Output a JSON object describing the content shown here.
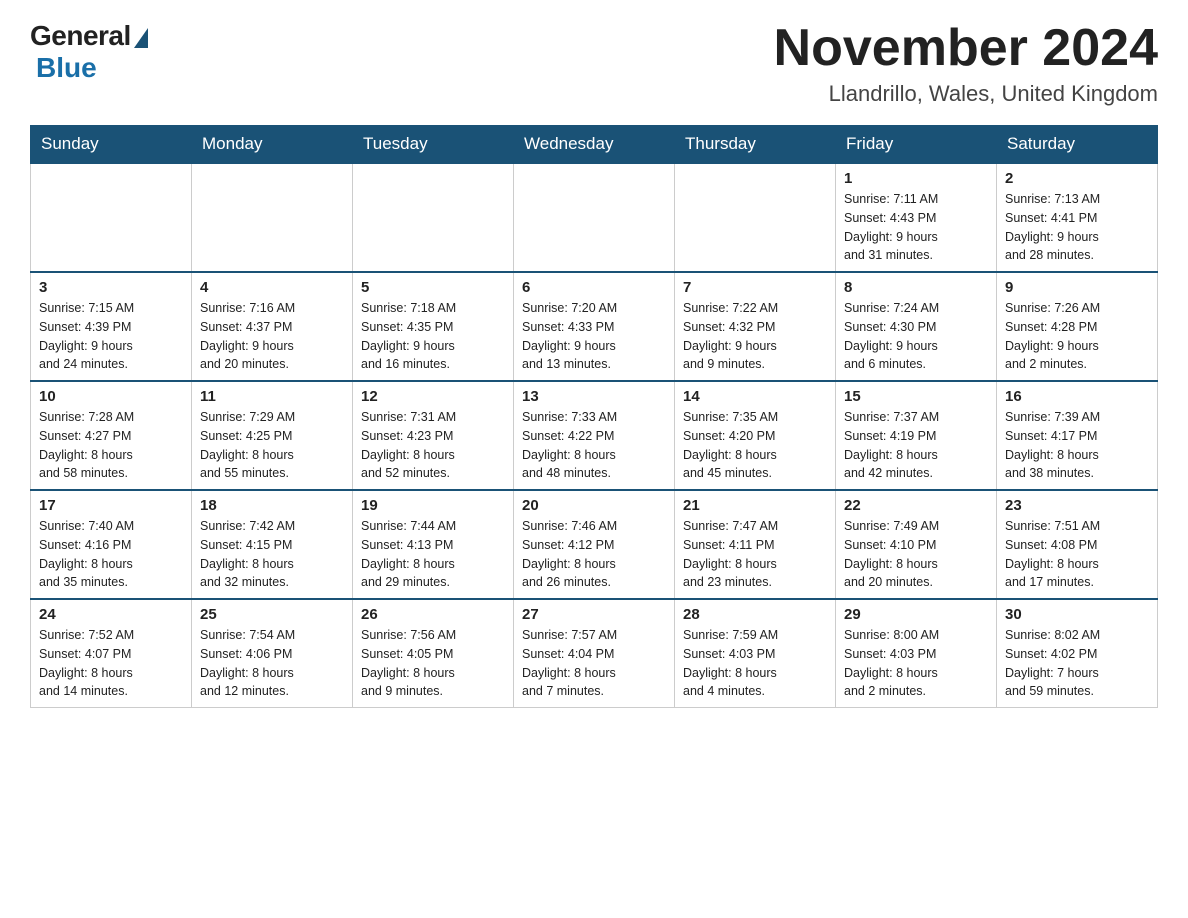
{
  "logo": {
    "text_general": "General",
    "text_blue": "Blue"
  },
  "header": {
    "month_year": "November 2024",
    "location": "Llandrillo, Wales, United Kingdom"
  },
  "days_of_week": [
    "Sunday",
    "Monday",
    "Tuesday",
    "Wednesday",
    "Thursday",
    "Friday",
    "Saturday"
  ],
  "weeks": [
    [
      {
        "day": "",
        "info": ""
      },
      {
        "day": "",
        "info": ""
      },
      {
        "day": "",
        "info": ""
      },
      {
        "day": "",
        "info": ""
      },
      {
        "day": "",
        "info": ""
      },
      {
        "day": "1",
        "info": "Sunrise: 7:11 AM\nSunset: 4:43 PM\nDaylight: 9 hours\nand 31 minutes."
      },
      {
        "day": "2",
        "info": "Sunrise: 7:13 AM\nSunset: 4:41 PM\nDaylight: 9 hours\nand 28 minutes."
      }
    ],
    [
      {
        "day": "3",
        "info": "Sunrise: 7:15 AM\nSunset: 4:39 PM\nDaylight: 9 hours\nand 24 minutes."
      },
      {
        "day": "4",
        "info": "Sunrise: 7:16 AM\nSunset: 4:37 PM\nDaylight: 9 hours\nand 20 minutes."
      },
      {
        "day": "5",
        "info": "Sunrise: 7:18 AM\nSunset: 4:35 PM\nDaylight: 9 hours\nand 16 minutes."
      },
      {
        "day": "6",
        "info": "Sunrise: 7:20 AM\nSunset: 4:33 PM\nDaylight: 9 hours\nand 13 minutes."
      },
      {
        "day": "7",
        "info": "Sunrise: 7:22 AM\nSunset: 4:32 PM\nDaylight: 9 hours\nand 9 minutes."
      },
      {
        "day": "8",
        "info": "Sunrise: 7:24 AM\nSunset: 4:30 PM\nDaylight: 9 hours\nand 6 minutes."
      },
      {
        "day": "9",
        "info": "Sunrise: 7:26 AM\nSunset: 4:28 PM\nDaylight: 9 hours\nand 2 minutes."
      }
    ],
    [
      {
        "day": "10",
        "info": "Sunrise: 7:28 AM\nSunset: 4:27 PM\nDaylight: 8 hours\nand 58 minutes."
      },
      {
        "day": "11",
        "info": "Sunrise: 7:29 AM\nSunset: 4:25 PM\nDaylight: 8 hours\nand 55 minutes."
      },
      {
        "day": "12",
        "info": "Sunrise: 7:31 AM\nSunset: 4:23 PM\nDaylight: 8 hours\nand 52 minutes."
      },
      {
        "day": "13",
        "info": "Sunrise: 7:33 AM\nSunset: 4:22 PM\nDaylight: 8 hours\nand 48 minutes."
      },
      {
        "day": "14",
        "info": "Sunrise: 7:35 AM\nSunset: 4:20 PM\nDaylight: 8 hours\nand 45 minutes."
      },
      {
        "day": "15",
        "info": "Sunrise: 7:37 AM\nSunset: 4:19 PM\nDaylight: 8 hours\nand 42 minutes."
      },
      {
        "day": "16",
        "info": "Sunrise: 7:39 AM\nSunset: 4:17 PM\nDaylight: 8 hours\nand 38 minutes."
      }
    ],
    [
      {
        "day": "17",
        "info": "Sunrise: 7:40 AM\nSunset: 4:16 PM\nDaylight: 8 hours\nand 35 minutes."
      },
      {
        "day": "18",
        "info": "Sunrise: 7:42 AM\nSunset: 4:15 PM\nDaylight: 8 hours\nand 32 minutes."
      },
      {
        "day": "19",
        "info": "Sunrise: 7:44 AM\nSunset: 4:13 PM\nDaylight: 8 hours\nand 29 minutes."
      },
      {
        "day": "20",
        "info": "Sunrise: 7:46 AM\nSunset: 4:12 PM\nDaylight: 8 hours\nand 26 minutes."
      },
      {
        "day": "21",
        "info": "Sunrise: 7:47 AM\nSunset: 4:11 PM\nDaylight: 8 hours\nand 23 minutes."
      },
      {
        "day": "22",
        "info": "Sunrise: 7:49 AM\nSunset: 4:10 PM\nDaylight: 8 hours\nand 20 minutes."
      },
      {
        "day": "23",
        "info": "Sunrise: 7:51 AM\nSunset: 4:08 PM\nDaylight: 8 hours\nand 17 minutes."
      }
    ],
    [
      {
        "day": "24",
        "info": "Sunrise: 7:52 AM\nSunset: 4:07 PM\nDaylight: 8 hours\nand 14 minutes."
      },
      {
        "day": "25",
        "info": "Sunrise: 7:54 AM\nSunset: 4:06 PM\nDaylight: 8 hours\nand 12 minutes."
      },
      {
        "day": "26",
        "info": "Sunrise: 7:56 AM\nSunset: 4:05 PM\nDaylight: 8 hours\nand 9 minutes."
      },
      {
        "day": "27",
        "info": "Sunrise: 7:57 AM\nSunset: 4:04 PM\nDaylight: 8 hours\nand 7 minutes."
      },
      {
        "day": "28",
        "info": "Sunrise: 7:59 AM\nSunset: 4:03 PM\nDaylight: 8 hours\nand 4 minutes."
      },
      {
        "day": "29",
        "info": "Sunrise: 8:00 AM\nSunset: 4:03 PM\nDaylight: 8 hours\nand 2 minutes."
      },
      {
        "day": "30",
        "info": "Sunrise: 8:02 AM\nSunset: 4:02 PM\nDaylight: 7 hours\nand 59 minutes."
      }
    ]
  ]
}
